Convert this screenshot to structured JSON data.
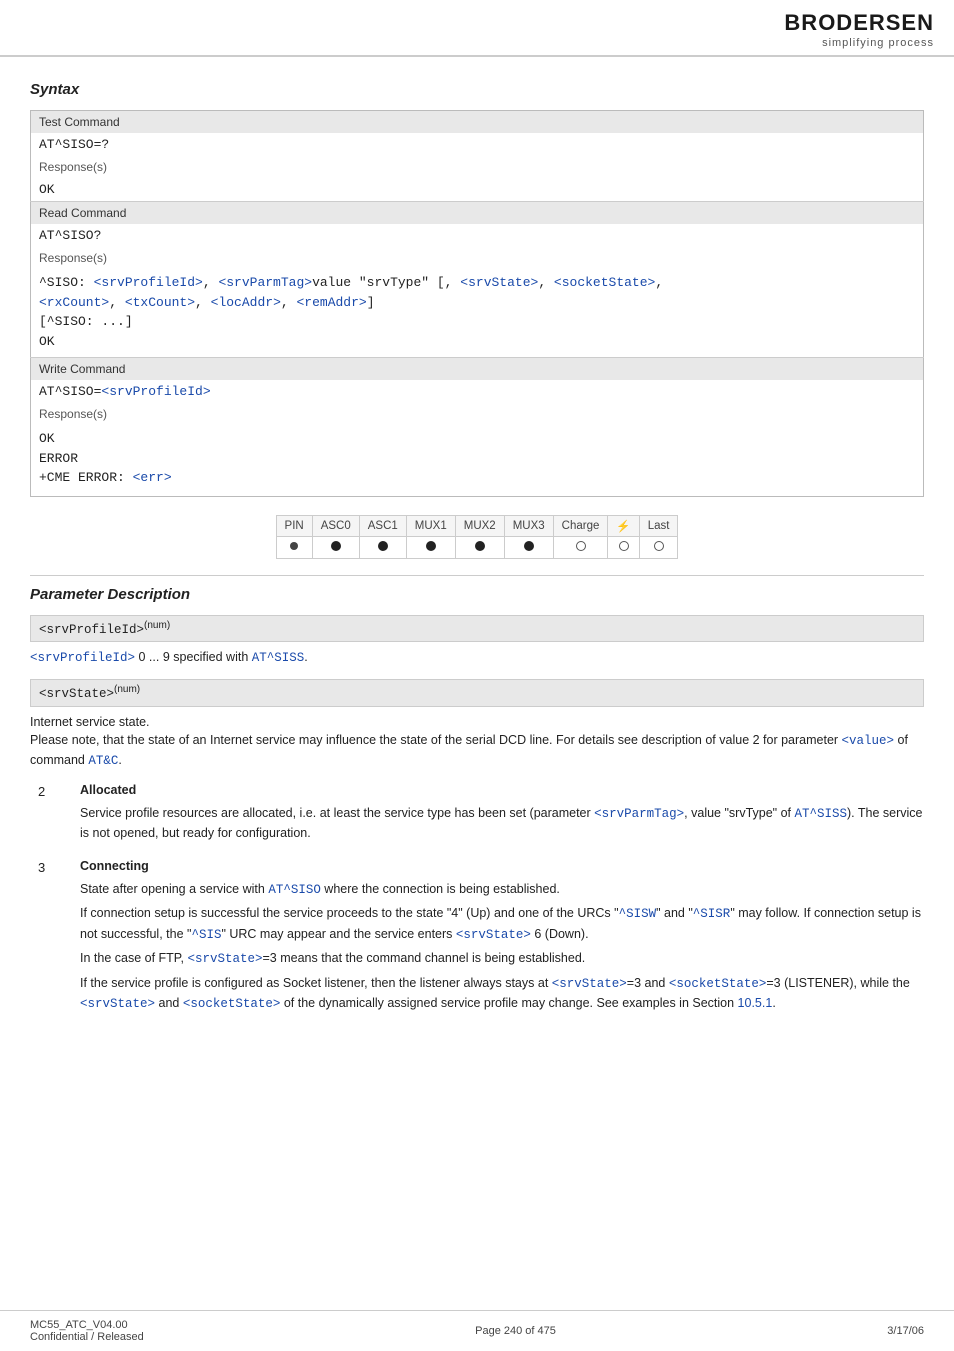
{
  "header": {
    "logo_brand": "BRODERSEN",
    "logo_subtitle": "simplifying process"
  },
  "syntax_section": {
    "title": "Syntax",
    "test_command_label": "Test Command",
    "test_command_code": "AT^SISO=?",
    "test_command_response_label": "Response(s)",
    "test_command_response_code": "OK",
    "read_command_label": "Read Command",
    "read_command_code": "AT^SISO?",
    "read_command_response_label": "Response(s)",
    "read_command_response_code1": "^SISO: <srvProfileId>, <srvParmTag>value \"srvType\" [, <srvState>, <socketState>,",
    "read_command_response_code2": "<rxCount>, <txCount>, <locAddr>, <remAddr>]",
    "read_command_response_code3": "[^SISO: ...]",
    "read_command_response_code4": "OK",
    "write_command_label": "Write Command",
    "write_command_code": "AT^SISO=<srvProfileId>",
    "write_command_response_label": "Response(s)",
    "write_command_response_ok": "OK",
    "write_command_response_error": "ERROR",
    "write_command_response_cme": "+CME ERROR: <err>"
  },
  "status_table": {
    "headers": [
      "PIN",
      "ASC0",
      "ASC1",
      "MUX1",
      "MUX2",
      "MUX3",
      "Charge",
      "⚡",
      "Last"
    ],
    "row": [
      "filled_small",
      "filled",
      "filled",
      "filled",
      "filled",
      "filled",
      "empty",
      "empty",
      "empty"
    ]
  },
  "param_description": {
    "title": "Parameter Description",
    "params": [
      {
        "name": "<srvProfileId>",
        "superscript": "(num)",
        "description": "<srvProfileId> 0 ... 9 specified with AT^SISS.",
        "items": []
      },
      {
        "name": "<srvState>",
        "superscript": "(num)",
        "description": "Internet service state.\nPlease note, that the state of an Internet service may influence the state of the serial DCD line. For details see description of value 2 for parameter <value> of command AT&C.",
        "items": [
          {
            "num": "2",
            "title": "Allocated",
            "body": "Service profile resources are allocated, i.e. at least the service type has been set (parameter <srvParmTag>, value \"srvType\" of AT^SISS). The service is not opened, but ready for configuration."
          },
          {
            "num": "3",
            "title": "Connecting",
            "body": "State after opening a service with AT^SISO where the connection is being established.\nIf connection setup is successful the service proceeds to the state \"4\" (Up) and one of the URCs \"^SISW\" and \"^SISR\" may follow. If connection setup is not successful, the \"^SIS\" URC may appear and the service enters <srvState> 6 (Down).\nIn the case of FTP, <srvState>=3 means that the command channel is being established.\nIf the service profile is configured as Socket listener, then the listener always stays at <srvState>=3 and <socketState>=3 (LISTENER), while the <srvState> and <socketState> of the dynamically assigned service profile may change. See examples in Section 10.5.1."
          }
        ]
      }
    ]
  },
  "footer": {
    "left_top": "MC55_ATC_V04.00",
    "left_bottom": "Confidential / Released",
    "center": "Page 240 of 475",
    "right": "3/17/06"
  }
}
